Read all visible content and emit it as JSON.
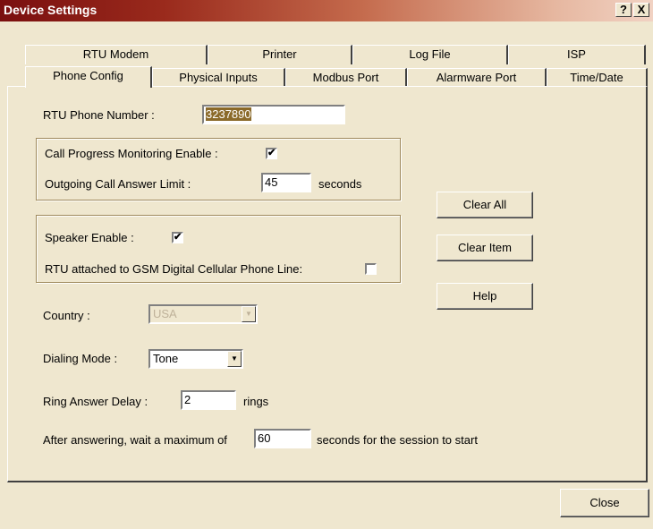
{
  "window": {
    "title": "Device Settings",
    "help_label": "?",
    "close_label": "X"
  },
  "tabs_back": [
    "RTU Modem",
    "Printer",
    "Log File",
    "ISP"
  ],
  "tabs_front": [
    "Phone Config",
    "Physical Inputs",
    "Modbus Port",
    "Alarmware Port",
    "Time/Date"
  ],
  "active_tab": "Phone Config",
  "phone_number": {
    "label": "RTU Phone Number :",
    "value": "3237890"
  },
  "call_progress": {
    "monitoring_label": "Call Progress Monitoring Enable :",
    "monitoring_checked": true,
    "limit_label": "Outgoing Call Answer Limit :",
    "limit_value": "45",
    "limit_unit": "seconds"
  },
  "speaker": {
    "enable_label": "Speaker Enable :",
    "enable_checked": true,
    "gsm_label": "RTU attached to GSM Digital Cellular Phone Line:",
    "gsm_checked": false
  },
  "country": {
    "label": "Country :",
    "value": "USA",
    "disabled": true
  },
  "dialing_mode": {
    "label": "Dialing Mode :",
    "value": "Tone"
  },
  "ring_delay": {
    "label": "Ring Answer Delay :",
    "value": "2",
    "unit": "rings"
  },
  "session_wait": {
    "label_before": "After answering, wait a maximum of",
    "value": "60",
    "label_after": "seconds for the session to start"
  },
  "buttons": {
    "clear_all": "Clear All",
    "clear_item": "Clear Item",
    "help": "Help",
    "close": "Close"
  },
  "check_mark": "✔"
}
